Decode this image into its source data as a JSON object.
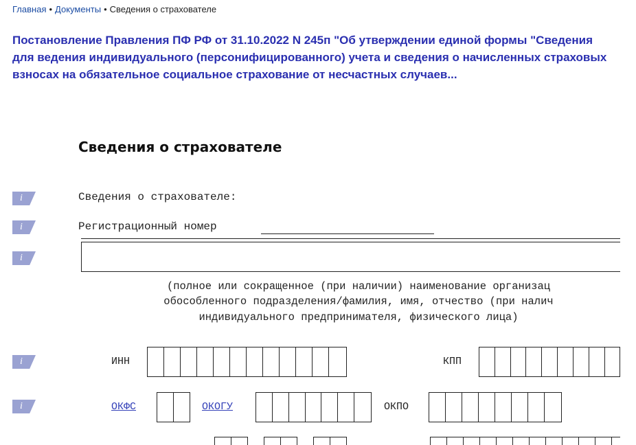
{
  "breadcrumb": {
    "items": [
      "Главная",
      "Документы",
      "Сведения о страхователе"
    ],
    "separator": "•"
  },
  "page_title": "Постановление Правления ПФ РФ от 31.10.2022 N 245п \"Об утверждении единой формы \"Сведения для ведения индивидуального (персонифицированного) учета и сведения о начисленных страховых взносах на обязательное социальное страхование от несчастных случаев...",
  "section_title": "Сведения о страхователе",
  "info_icon_glyph": "i",
  "form": {
    "heading": "Сведения о страхователе:",
    "reg_number_label": "Регистрационный номер",
    "name_caption": [
      "(полное или сокращенное (при наличии) наименование организац",
      "обособленного подразделения/фамилия, имя, отчество (при налич",
      "индивидуального предпринимателя, физического лица)"
    ],
    "inn_label": "ИНН",
    "kpp_label": "КПП",
    "okfs_label": "ОКФС",
    "okogu_label": "ОКОГУ",
    "okpo_label": "ОКПО"
  },
  "colors": {
    "title": "#2a2fb0",
    "link": "#1b4ca3",
    "icon": "#9aa2d2"
  }
}
